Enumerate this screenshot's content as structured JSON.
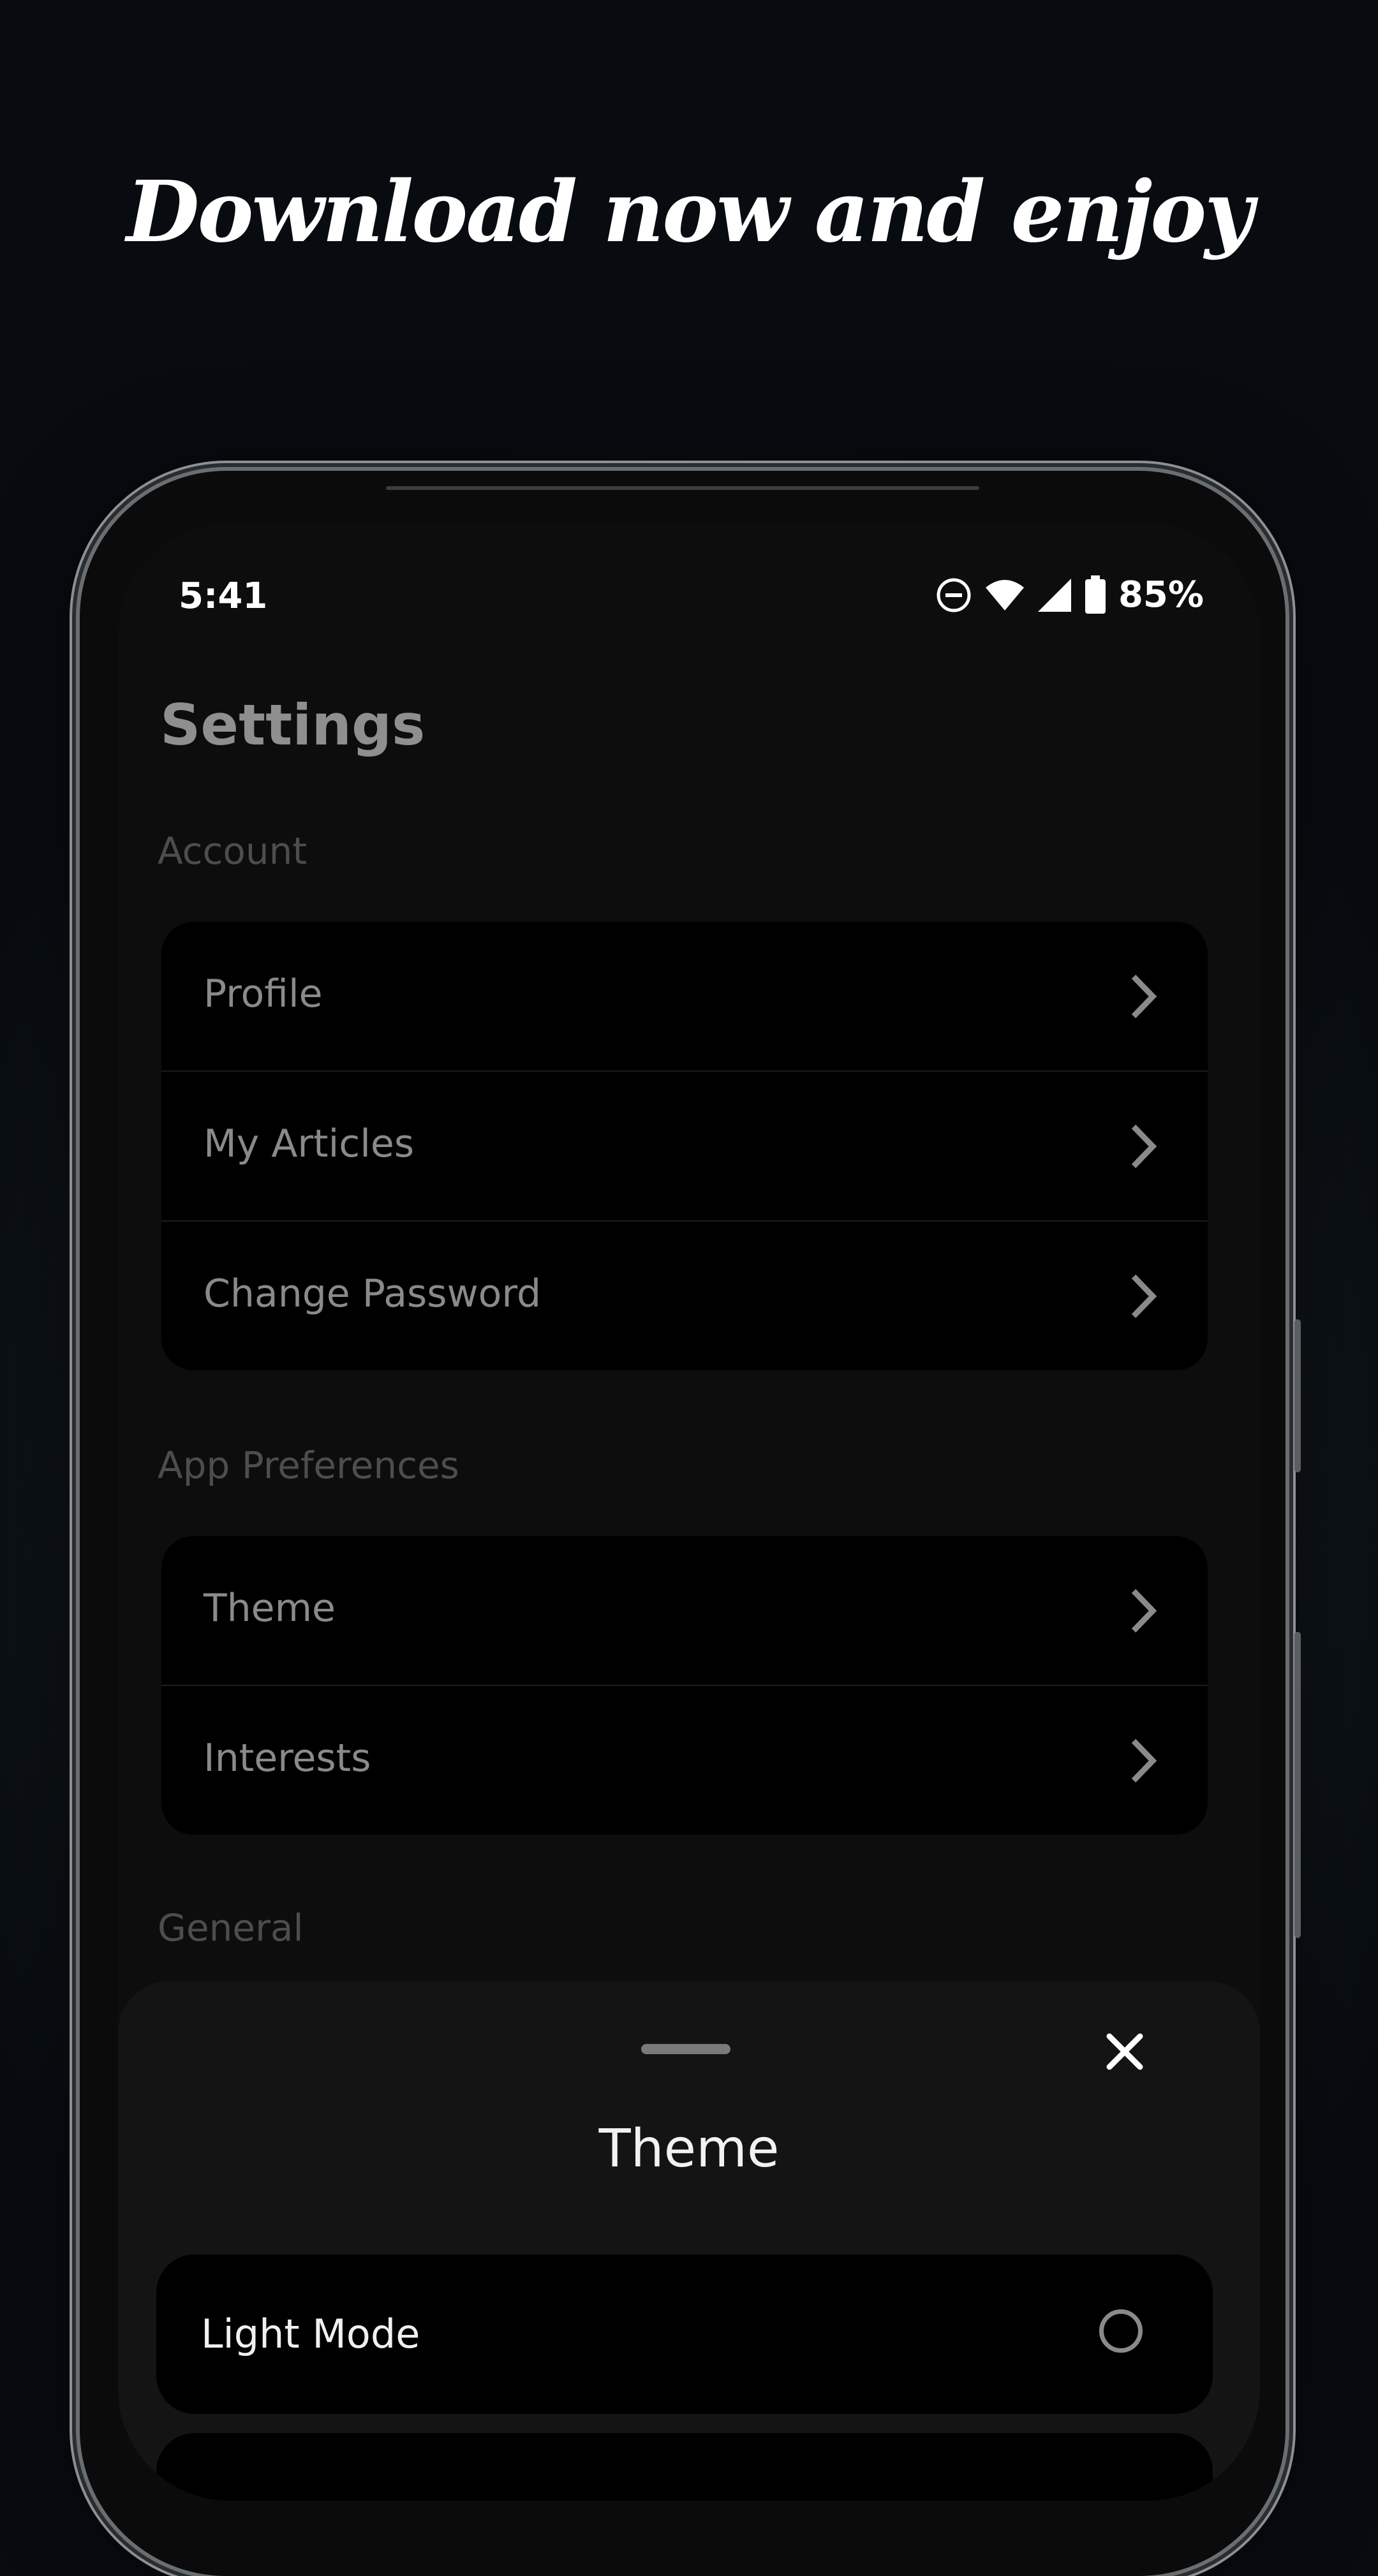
{
  "promo": {
    "headline": "Download now and enjoy"
  },
  "status_bar": {
    "time": "5:41",
    "battery_percent": "85%",
    "icons": [
      "do-not-disturb-icon",
      "wifi-icon",
      "signal-icon",
      "battery-icon"
    ]
  },
  "settings": {
    "title": "Settings",
    "sections": [
      {
        "label": "Account",
        "items": [
          "Profile",
          "My Articles",
          "Change Password"
        ]
      },
      {
        "label": "App Preferences",
        "items": [
          "Theme",
          "Interests"
        ]
      },
      {
        "label": "General",
        "items": []
      }
    ]
  },
  "theme_sheet": {
    "title": "Theme",
    "options": [
      {
        "label": "Light Mode",
        "selected": false
      }
    ]
  },
  "colors": {
    "background": "#0b0f13",
    "card": "#000000",
    "sheet": "#141414",
    "text_primary": "#f2f2f2",
    "text_muted": "#8a8a8a"
  }
}
